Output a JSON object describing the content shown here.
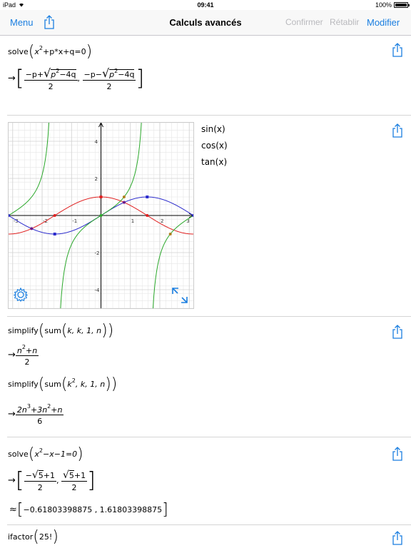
{
  "status": {
    "carrier": "iPad",
    "time": "09:41",
    "battery": "100%"
  },
  "nav": {
    "menu": "Menu",
    "title": "Calculs avancés",
    "confirm": "Confirmer",
    "redo": "Rétablir",
    "edit": "Modifier"
  },
  "cells": {
    "c1": {
      "fn": "solve",
      "eq_a": "x",
      "eq_exp": "2",
      "eq_b": "+p*x+q=0",
      "r1_num_a": "−p+",
      "r1_rad": "p",
      "r1_rad_exp": "2",
      "r1_rad_b": "−4q",
      "r1_den": "2",
      "r2_num_a": "−p−",
      "r2_rad": "p",
      "r2_rad_exp": "2",
      "r2_rad_b": "−4q",
      "r2_den": "2"
    },
    "graph": {
      "legend": [
        "sin(x)",
        "cos(x)",
        "tan(x)"
      ]
    },
    "c3": {
      "fn1": "simplify",
      "fn2": "sum",
      "args1": "k, k, 1, n",
      "r1_num_a": "n",
      "r1_num_exp": "2",
      "r1_num_b": "+n",
      "r1_den": "2",
      "args2_a": "k",
      "args2_exp": "2",
      "args2_b": ", k, 1, n",
      "r2_num": "2n",
      "r2_exp1": "3",
      "r2_mid": "+3n",
      "r2_exp2": "2",
      "r2_end": "+n",
      "r2_den": "6"
    },
    "c4": {
      "fn": "solve",
      "eq_a": "x",
      "eq_exp": "2",
      "eq_b": "−x−1=0",
      "r1_a": "−",
      "r1_rad": "5",
      "r1_b": "+1",
      "r1_den": "2",
      "r2_rad": "5",
      "r2_b": "+1",
      "r2_den": "2",
      "approx": "≈",
      "approx_vals": "−0.61803398875 , 1.61803398875"
    },
    "c5": {
      "fn": "ifactor",
      "arg": "25!"
    }
  },
  "chart_data": {
    "type": "line",
    "xlim": [
      -3.14,
      3.14
    ],
    "ylim": [
      -5,
      5
    ],
    "x_ticks": [
      "-3",
      "-2",
      "-1",
      "1",
      "2",
      "3"
    ],
    "y_ticks": [
      "4",
      "2",
      "-2",
      "-4"
    ],
    "grid": true,
    "series": [
      {
        "name": "sin(x)",
        "color": "#2b2bcc"
      },
      {
        "name": "cos(x)",
        "color": "#e02020"
      },
      {
        "name": "tan(x)",
        "color": "#2aa82a"
      }
    ]
  },
  "colors": {
    "accent": "#1a7ee0",
    "disabled": "#b9b9bd"
  }
}
